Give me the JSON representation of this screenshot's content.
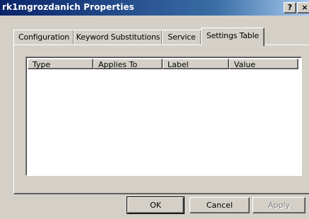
{
  "window": {
    "title": "rk1mgrozdanich Properties",
    "help_button": "?",
    "close_button": "×"
  },
  "tabs": [
    {
      "label": "Configuration",
      "active": false
    },
    {
      "label": "Keyword Substitutions",
      "active": false
    },
    {
      "label": "Service",
      "active": false
    },
    {
      "label": "Settings Table",
      "active": true
    }
  ],
  "settings_table": {
    "columns": [
      "Type",
      "Applies To",
      "Label",
      "Value"
    ],
    "rows": []
  },
  "buttons": {
    "ok": "OK",
    "cancel": "Cancel",
    "apply": "Apply"
  },
  "colors": {
    "titlebar_start": "#0a246a",
    "titlebar_end": "#a6caf0",
    "face": "#d4d0c8"
  }
}
